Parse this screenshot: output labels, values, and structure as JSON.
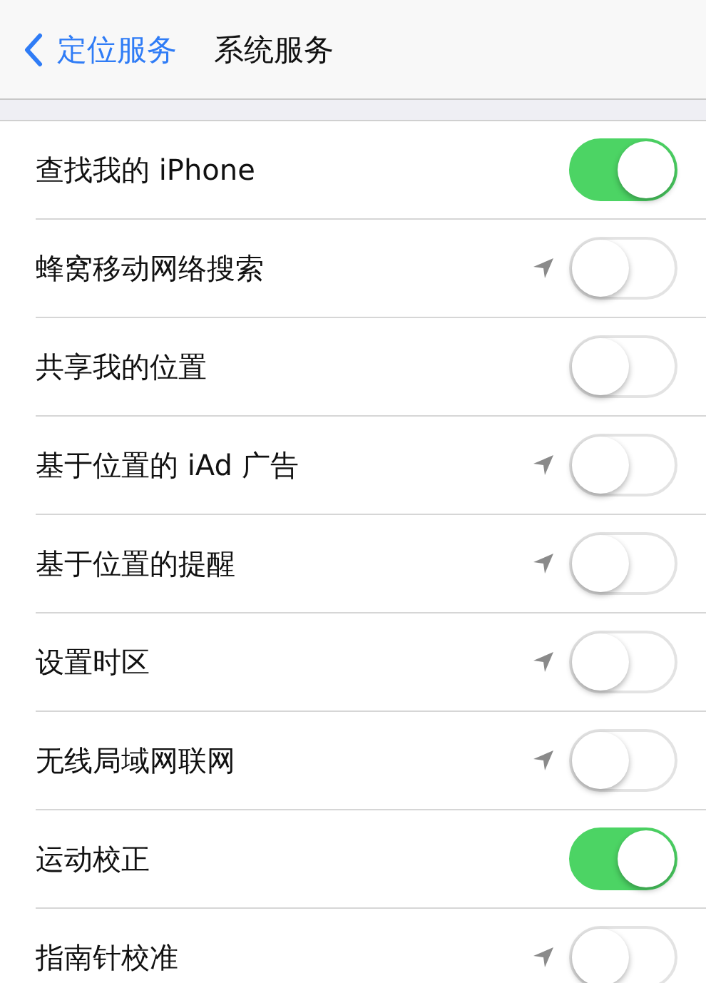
{
  "nav_bar": {
    "back_label": "定位服务",
    "title": "系统服务"
  },
  "rows": [
    {
      "label": "查找我的 iPhone",
      "location_icon": false,
      "on": true
    },
    {
      "label": "蜂窝移动网络搜索",
      "location_icon": true,
      "on": false
    },
    {
      "label": "共享我的位置",
      "location_icon": false,
      "on": false
    },
    {
      "label": "基于位置的 iAd 广告",
      "location_icon": true,
      "on": false
    },
    {
      "label": "基于位置的提醒",
      "location_icon": true,
      "on": false
    },
    {
      "label": "设置时区",
      "location_icon": true,
      "on": false
    },
    {
      "label": "无线局域网联网",
      "location_icon": true,
      "on": false
    },
    {
      "label": "运动校正",
      "location_icon": false,
      "on": true
    },
    {
      "label": "指南针校准",
      "location_icon": true,
      "on": false
    }
  ]
}
